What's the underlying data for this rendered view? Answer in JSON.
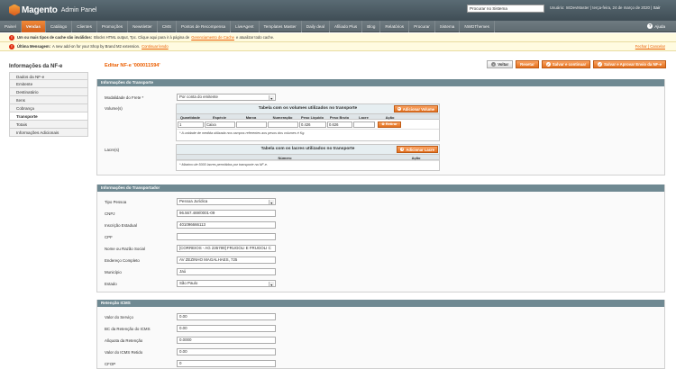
{
  "header": {
    "logo_text": "Magento",
    "logo_sub": "Admin Panel",
    "search_placeholder": "Procurar no Sistema",
    "user_prefix": "Usuário:",
    "user_name": "IntDevMaster",
    "date": "terça-feira, 24 de março de 2020",
    "logout": "Sair"
  },
  "nav": {
    "items": [
      "Painel",
      "Vendas",
      "Catálogo",
      "Clientes",
      "Promoções",
      "Newsletter",
      "CMS",
      "Pontos de Recompensa",
      "LiveAgent",
      "Templates Master",
      "Daily deal",
      "Afiliado Plus",
      "Blog",
      "Relatórios",
      "Procurar",
      "Sistema",
      "NWDThemes"
    ],
    "active": "Vendas",
    "help": "Ajuda"
  },
  "messages": {
    "cache_bold": "Um ou mais tipos de cache são inválidos:",
    "cache_text": "Blocks HTML output, Tpc. Clique aqui para ir à página de",
    "cache_link": "Gerenciamento de Cache",
    "cache_tail": "e atualizar todo cache.",
    "news_bold": "Última Mensagem:",
    "news_text": "A new add-on for your Shop by Brand M2 extension.",
    "news_link": "Continuar lendo",
    "news_right": "Fechar | Cancelar"
  },
  "sidebar": {
    "title": "Informações da NF-e",
    "items": [
      "Dados da NF-e",
      "Emitente",
      "Destinatário",
      "Itens",
      "Cobrança",
      "Transporte",
      "Totais",
      "Informações Adicionais"
    ],
    "active": "Transporte"
  },
  "page": {
    "title": "Editar NF-e '000011594'",
    "buttons": {
      "back": "Voltar",
      "reset": "Resetar",
      "save_continue": "Salvar e continuar",
      "save_approve": "Salvar e Aprovar Envio da NF-e"
    }
  },
  "transporte": {
    "title": "Informações do Transporte",
    "modalidade_label": "Modalidade do Frete *",
    "modalidade_value": "Por conta do emitente",
    "volumes_label": "Volume(s)",
    "volumes_table": {
      "title": "Tabela com os volumes utilizados no transporte",
      "add_label": "Adicionar Volume",
      "headers": [
        "Quantidade",
        "Espécie",
        "Marca",
        "Numeração",
        "Peso Líquido",
        "Peso Bruto",
        "Lacre",
        "Ação"
      ],
      "row": {
        "quantidade": "1",
        "especie": "Caixa",
        "marca": "",
        "numeracao": "",
        "peso_liquido": "0.426",
        "peso_bruto": "0.626",
        "lacre": ""
      },
      "remove_label": "Retirar",
      "note": "* A unidade de medida utilizada nos campos referentes aos pesos dos volumes é Kg."
    },
    "lacres_label": "Lacre(s)",
    "lacres_table": {
      "title": "Tabela com os lacres utilizados no transporte",
      "add_label": "Adicionar Lacre",
      "headers": [
        "Número",
        "Ação"
      ],
      "note": "* Máximo de 5000 lacres permitidos por transporte na NF-e."
    }
  },
  "transportador": {
    "title": "Informações do Transportador",
    "fields": [
      {
        "label": "Tipo Pessoa",
        "value": "Pessoa Jurídica"
      },
      {
        "label": "CNPJ",
        "value": "96.567.469/0001-09"
      },
      {
        "label": "Inscrição Estadual",
        "value": "401096666113"
      },
      {
        "label": "CPF",
        "value": ""
      },
      {
        "label": "Nome ou Razão Social",
        "value": "[CORREIOS - AG 235789] FRUGOLI E FRUGOLI C"
      },
      {
        "label": "Endereço Completo",
        "value": "AV ZEZINHO MAGALHAES, 725"
      },
      {
        "label": "Município",
        "value": "Jaú"
      },
      {
        "label": "Estado",
        "value": "São Paulo"
      }
    ]
  },
  "retencao": {
    "title": "Retenção ICMS",
    "fields": [
      {
        "label": "Valor do Serviço",
        "value": "0.00"
      },
      {
        "label": "BC da Retenção do ICMS",
        "value": "0.00"
      },
      {
        "label": "Alíquota da Retenção",
        "value": "0.0000"
      },
      {
        "label": "Valor do ICMS Retido",
        "value": "0.00"
      },
      {
        "label": "CFOP",
        "value": "0"
      }
    ]
  },
  "colors": {
    "accent": "#eb5e00",
    "section_header": "#6f8992",
    "header_bg": "#4a5a63"
  }
}
